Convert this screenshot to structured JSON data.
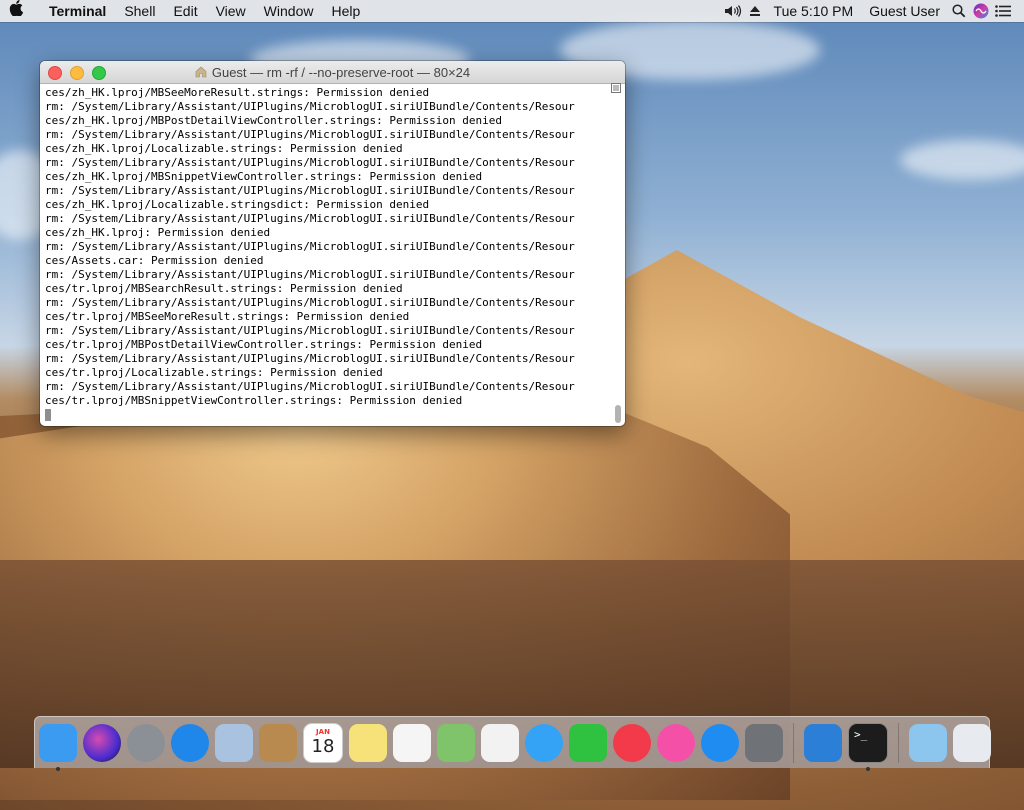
{
  "menubar": {
    "app_name": "Terminal",
    "menus": [
      "Shell",
      "Edit",
      "View",
      "Window",
      "Help"
    ],
    "clock": "Tue 5:10 PM",
    "user": "Guest User",
    "icons": [
      "apple-icon",
      "volume-icon",
      "eject-icon",
      "search-icon",
      "siri-icon",
      "notification-center-icon"
    ]
  },
  "terminal": {
    "title": "Guest — rm -rf / --no-preserve-root — 80×24",
    "lines": [
      "ces/zh_HK.lproj/MBSeeMoreResult.strings: Permission denied",
      "rm: /System/Library/Assistant/UIPlugins/MicroblogUI.siriUIBundle/Contents/Resour",
      "ces/zh_HK.lproj/MBPostDetailViewController.strings: Permission denied",
      "rm: /System/Library/Assistant/UIPlugins/MicroblogUI.siriUIBundle/Contents/Resour",
      "ces/zh_HK.lproj/Localizable.strings: Permission denied",
      "rm: /System/Library/Assistant/UIPlugins/MicroblogUI.siriUIBundle/Contents/Resour",
      "ces/zh_HK.lproj/MBSnippetViewController.strings: Permission denied",
      "rm: /System/Library/Assistant/UIPlugins/MicroblogUI.siriUIBundle/Contents/Resour",
      "ces/zh_HK.lproj/Localizable.stringsdict: Permission denied",
      "rm: /System/Library/Assistant/UIPlugins/MicroblogUI.siriUIBundle/Contents/Resour",
      "ces/zh_HK.lproj: Permission denied",
      "rm: /System/Library/Assistant/UIPlugins/MicroblogUI.siriUIBundle/Contents/Resour",
      "ces/Assets.car: Permission denied",
      "rm: /System/Library/Assistant/UIPlugins/MicroblogUI.siriUIBundle/Contents/Resour",
      "ces/tr.lproj/MBSearchResult.strings: Permission denied",
      "rm: /System/Library/Assistant/UIPlugins/MicroblogUI.siriUIBundle/Contents/Resour",
      "ces/tr.lproj/MBSeeMoreResult.strings: Permission denied",
      "rm: /System/Library/Assistant/UIPlugins/MicroblogUI.siriUIBundle/Contents/Resour",
      "ces/tr.lproj/MBPostDetailViewController.strings: Permission denied",
      "rm: /System/Library/Assistant/UIPlugins/MicroblogUI.siriUIBundle/Contents/Resour",
      "ces/tr.lproj/Localizable.strings: Permission denied",
      "rm: /System/Library/Assistant/UIPlugins/MicroblogUI.siriUIBundle/Contents/Resour",
      "ces/tr.lproj/MBSnippetViewController.strings: Permission denied"
    ]
  },
  "dock": {
    "calendar_month": "JAN",
    "calendar_day": "18",
    "apps": [
      {
        "name": "finder-icon",
        "color": "#3a9bf0",
        "running": true
      },
      {
        "name": "siri-icon",
        "color": "#6a3fd0",
        "running": false
      },
      {
        "name": "launchpad-icon",
        "color": "#8b8f96",
        "running": false
      },
      {
        "name": "safari-icon",
        "color": "#1f86ea",
        "running": false
      },
      {
        "name": "mail-icon",
        "color": "#a8c2df",
        "running": false
      },
      {
        "name": "contacts-icon",
        "color": "#b98a4f",
        "running": false
      },
      {
        "name": "calendar-icon",
        "color": "#ffffff",
        "running": false
      },
      {
        "name": "notes-icon",
        "color": "#f7e27a",
        "running": false
      },
      {
        "name": "reminders-icon",
        "color": "#f5f5f5",
        "running": false
      },
      {
        "name": "maps-icon",
        "color": "#7fc36b",
        "running": false
      },
      {
        "name": "photos-icon",
        "color": "#f2f2f2",
        "running": false
      },
      {
        "name": "messages-icon",
        "color": "#35a3f5",
        "running": false
      },
      {
        "name": "facetime-icon",
        "color": "#2fc140",
        "running": false
      },
      {
        "name": "news-icon",
        "color": "#f23a4a",
        "running": false
      },
      {
        "name": "itunes-icon",
        "color": "#f550a8",
        "running": false
      },
      {
        "name": "app-store-icon",
        "color": "#1f8cf2",
        "running": false
      },
      {
        "name": "system-preferences-icon",
        "color": "#6f7277",
        "running": false
      },
      {
        "name": "window-manager-icon",
        "color": "#2c7fd6",
        "running": false
      },
      {
        "name": "terminal-icon",
        "color": "#1c1c1c",
        "running": true
      },
      {
        "name": "downloads-folder-icon",
        "color": "#8cc6ee",
        "running": false
      },
      {
        "name": "trash-icon",
        "color": "#e7eaee",
        "running": false
      }
    ]
  }
}
